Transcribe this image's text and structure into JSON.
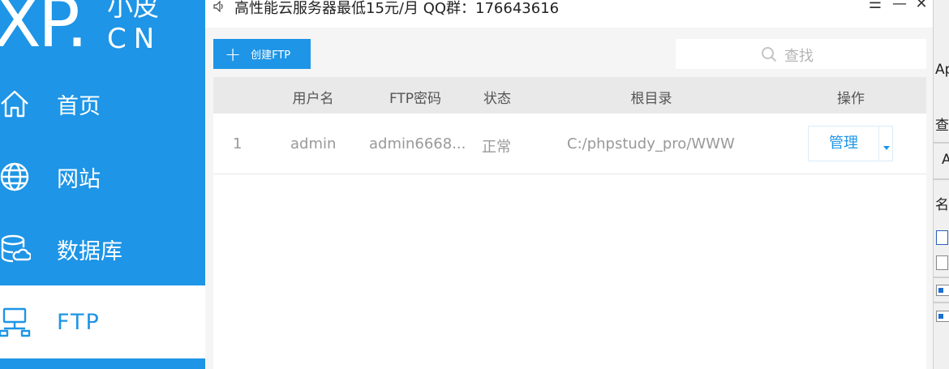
{
  "colors": {
    "brand_blue": "#1e95e6",
    "header_gray": "#e9e9e9",
    "muted_text": "#999999"
  },
  "logo": {
    "main": "XP.",
    "small": "小皮",
    "cn": "CN"
  },
  "sidebar": {
    "items": [
      {
        "label": "首页",
        "icon": "home-icon",
        "active": false
      },
      {
        "label": "网站",
        "icon": "globe-icon",
        "active": false
      },
      {
        "label": "数据库",
        "icon": "database-icon",
        "active": false
      },
      {
        "label": "FTP",
        "icon": "ftp-network-icon",
        "active": true
      }
    ]
  },
  "titlebar": {
    "ad_text": "高性能云服务器最低15元/月  QQ群：176643616",
    "menu_symbol": "☰",
    "minimize_symbol": "—",
    "close_symbol": "✕"
  },
  "toolbar": {
    "create_plus": "+",
    "create_label": "创建FTP"
  },
  "search": {
    "placeholder": "查找"
  },
  "table": {
    "headers": {
      "username": "用户名",
      "password": "FTP密码",
      "status": "状态",
      "root": "根目录",
      "action": "操作"
    },
    "rows": [
      {
        "index": "1",
        "username": "admin",
        "password": "admin6668...",
        "status": "正常",
        "root": "C:/phpstudy_pro/WWW",
        "manage_label": "管理"
      }
    ]
  },
  "edge_window": {
    "t1": "Ap",
    "t2": "查看",
    "t3": "A",
    "t4": "名称"
  }
}
